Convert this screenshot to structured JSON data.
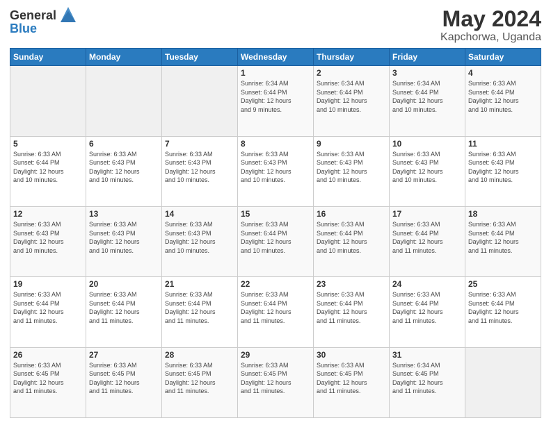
{
  "header": {
    "logo_line1": "General",
    "logo_line2": "Blue",
    "month": "May 2024",
    "location": "Kapchorwa, Uganda"
  },
  "days_of_week": [
    "Sunday",
    "Monday",
    "Tuesday",
    "Wednesday",
    "Thursday",
    "Friday",
    "Saturday"
  ],
  "weeks": [
    [
      {
        "day": "",
        "info": ""
      },
      {
        "day": "",
        "info": ""
      },
      {
        "day": "",
        "info": ""
      },
      {
        "day": "1",
        "info": "Sunrise: 6:34 AM\nSunset: 6:44 PM\nDaylight: 12 hours\nand 9 minutes."
      },
      {
        "day": "2",
        "info": "Sunrise: 6:34 AM\nSunset: 6:44 PM\nDaylight: 12 hours\nand 10 minutes."
      },
      {
        "day": "3",
        "info": "Sunrise: 6:34 AM\nSunset: 6:44 PM\nDaylight: 12 hours\nand 10 minutes."
      },
      {
        "day": "4",
        "info": "Sunrise: 6:33 AM\nSunset: 6:44 PM\nDaylight: 12 hours\nand 10 minutes."
      }
    ],
    [
      {
        "day": "5",
        "info": "Sunrise: 6:33 AM\nSunset: 6:44 PM\nDaylight: 12 hours\nand 10 minutes."
      },
      {
        "day": "6",
        "info": "Sunrise: 6:33 AM\nSunset: 6:43 PM\nDaylight: 12 hours\nand 10 minutes."
      },
      {
        "day": "7",
        "info": "Sunrise: 6:33 AM\nSunset: 6:43 PM\nDaylight: 12 hours\nand 10 minutes."
      },
      {
        "day": "8",
        "info": "Sunrise: 6:33 AM\nSunset: 6:43 PM\nDaylight: 12 hours\nand 10 minutes."
      },
      {
        "day": "9",
        "info": "Sunrise: 6:33 AM\nSunset: 6:43 PM\nDaylight: 12 hours\nand 10 minutes."
      },
      {
        "day": "10",
        "info": "Sunrise: 6:33 AM\nSunset: 6:43 PM\nDaylight: 12 hours\nand 10 minutes."
      },
      {
        "day": "11",
        "info": "Sunrise: 6:33 AM\nSunset: 6:43 PM\nDaylight: 12 hours\nand 10 minutes."
      }
    ],
    [
      {
        "day": "12",
        "info": "Sunrise: 6:33 AM\nSunset: 6:43 PM\nDaylight: 12 hours\nand 10 minutes."
      },
      {
        "day": "13",
        "info": "Sunrise: 6:33 AM\nSunset: 6:43 PM\nDaylight: 12 hours\nand 10 minutes."
      },
      {
        "day": "14",
        "info": "Sunrise: 6:33 AM\nSunset: 6:43 PM\nDaylight: 12 hours\nand 10 minutes."
      },
      {
        "day": "15",
        "info": "Sunrise: 6:33 AM\nSunset: 6:44 PM\nDaylight: 12 hours\nand 10 minutes."
      },
      {
        "day": "16",
        "info": "Sunrise: 6:33 AM\nSunset: 6:44 PM\nDaylight: 12 hours\nand 10 minutes."
      },
      {
        "day": "17",
        "info": "Sunrise: 6:33 AM\nSunset: 6:44 PM\nDaylight: 12 hours\nand 11 minutes."
      },
      {
        "day": "18",
        "info": "Sunrise: 6:33 AM\nSunset: 6:44 PM\nDaylight: 12 hours\nand 11 minutes."
      }
    ],
    [
      {
        "day": "19",
        "info": "Sunrise: 6:33 AM\nSunset: 6:44 PM\nDaylight: 12 hours\nand 11 minutes."
      },
      {
        "day": "20",
        "info": "Sunrise: 6:33 AM\nSunset: 6:44 PM\nDaylight: 12 hours\nand 11 minutes."
      },
      {
        "day": "21",
        "info": "Sunrise: 6:33 AM\nSunset: 6:44 PM\nDaylight: 12 hours\nand 11 minutes."
      },
      {
        "day": "22",
        "info": "Sunrise: 6:33 AM\nSunset: 6:44 PM\nDaylight: 12 hours\nand 11 minutes."
      },
      {
        "day": "23",
        "info": "Sunrise: 6:33 AM\nSunset: 6:44 PM\nDaylight: 12 hours\nand 11 minutes."
      },
      {
        "day": "24",
        "info": "Sunrise: 6:33 AM\nSunset: 6:44 PM\nDaylight: 12 hours\nand 11 minutes."
      },
      {
        "day": "25",
        "info": "Sunrise: 6:33 AM\nSunset: 6:44 PM\nDaylight: 12 hours\nand 11 minutes."
      }
    ],
    [
      {
        "day": "26",
        "info": "Sunrise: 6:33 AM\nSunset: 6:45 PM\nDaylight: 12 hours\nand 11 minutes."
      },
      {
        "day": "27",
        "info": "Sunrise: 6:33 AM\nSunset: 6:45 PM\nDaylight: 12 hours\nand 11 minutes."
      },
      {
        "day": "28",
        "info": "Sunrise: 6:33 AM\nSunset: 6:45 PM\nDaylight: 12 hours\nand 11 minutes."
      },
      {
        "day": "29",
        "info": "Sunrise: 6:33 AM\nSunset: 6:45 PM\nDaylight: 12 hours\nand 11 minutes."
      },
      {
        "day": "30",
        "info": "Sunrise: 6:33 AM\nSunset: 6:45 PM\nDaylight: 12 hours\nand 11 minutes."
      },
      {
        "day": "31",
        "info": "Sunrise: 6:34 AM\nSunset: 6:45 PM\nDaylight: 12 hours\nand 11 minutes."
      },
      {
        "day": "",
        "info": ""
      }
    ]
  ]
}
